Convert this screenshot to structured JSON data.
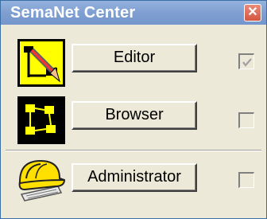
{
  "window": {
    "title": "SemaNet Center",
    "close_glyph": "✕"
  },
  "apps": [
    {
      "icon": "diagram-pencil-icon",
      "label": "Editor",
      "checked": true,
      "check_disabled": true
    },
    {
      "icon": "flowchart-icon",
      "label": "Browser",
      "checked": false
    },
    {
      "icon": "hardhat-icon",
      "label": "Administrator",
      "checked": false
    }
  ],
  "colors": {
    "title_bar": "#7f9fd1",
    "window_bg": "#ece9d8",
    "close_button": "#d4563f",
    "editor_icon_bg": "#ffff00",
    "browser_icon_bg": "#000000",
    "hardhat_yellow": "#ffe000"
  }
}
